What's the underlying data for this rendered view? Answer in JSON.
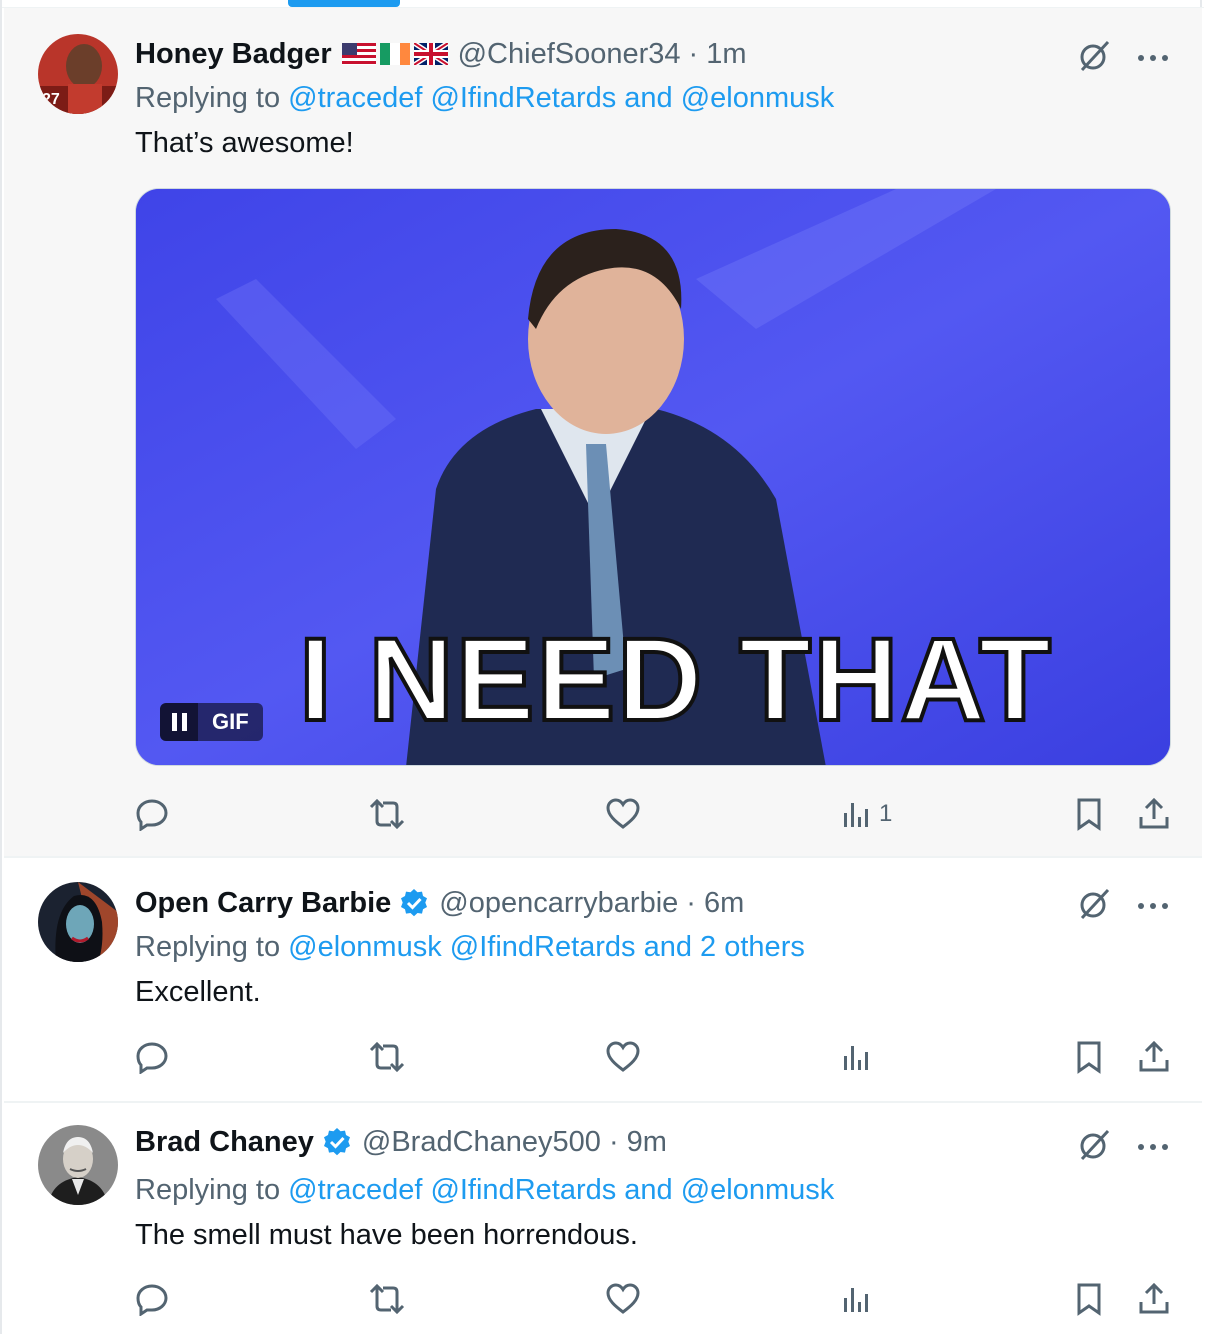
{
  "tweets": [
    {
      "name": "Honey Badger",
      "flags": [
        "us-flag-icon",
        "ireland-flag-icon",
        "uk-flag-icon"
      ],
      "handle": "@ChiefSooner34",
      "separator": "·",
      "time": "1m",
      "replying_prefix": "Replying to",
      "replying_links": "@tracedef @IfindRetards and @elonmusk",
      "text": "That’s awesome!",
      "media": {
        "type": "gif",
        "overlay_text": "I NEED THAT",
        "badge_label": "GIF",
        "colors": {
          "background": "#4a4ef0",
          "text": "#ffffff"
        }
      },
      "views_count": "1"
    },
    {
      "name": "Open Carry Barbie",
      "verified": true,
      "handle": "@opencarrybarbie",
      "separator": "·",
      "time": "6m",
      "replying_prefix": "Replying to",
      "replying_links": "@elonmusk @IfindRetards and 2 others",
      "text": "Excellent.",
      "views_count": ""
    },
    {
      "name": "Brad Chaney",
      "verified": true,
      "handle": "@BradChaney500",
      "separator": "·",
      "time": "9m",
      "replying_prefix": "Replying to",
      "replying_links": "@tracedef @IfindRetards and @elonmusk",
      "text": "The smell must have been horrendous.",
      "views_count": ""
    }
  ],
  "icons": {
    "top": [
      "grok-icon",
      "more-icon"
    ],
    "actions": [
      "reply-icon",
      "retweet-icon",
      "like-icon",
      "views-icon",
      "bookmark-icon",
      "share-icon"
    ]
  },
  "colors": {
    "accent": "#1d9bf0",
    "secondary_text": "#536471",
    "primary_text": "#0f1419",
    "highlighted_bg": "#f7f7f7"
  }
}
